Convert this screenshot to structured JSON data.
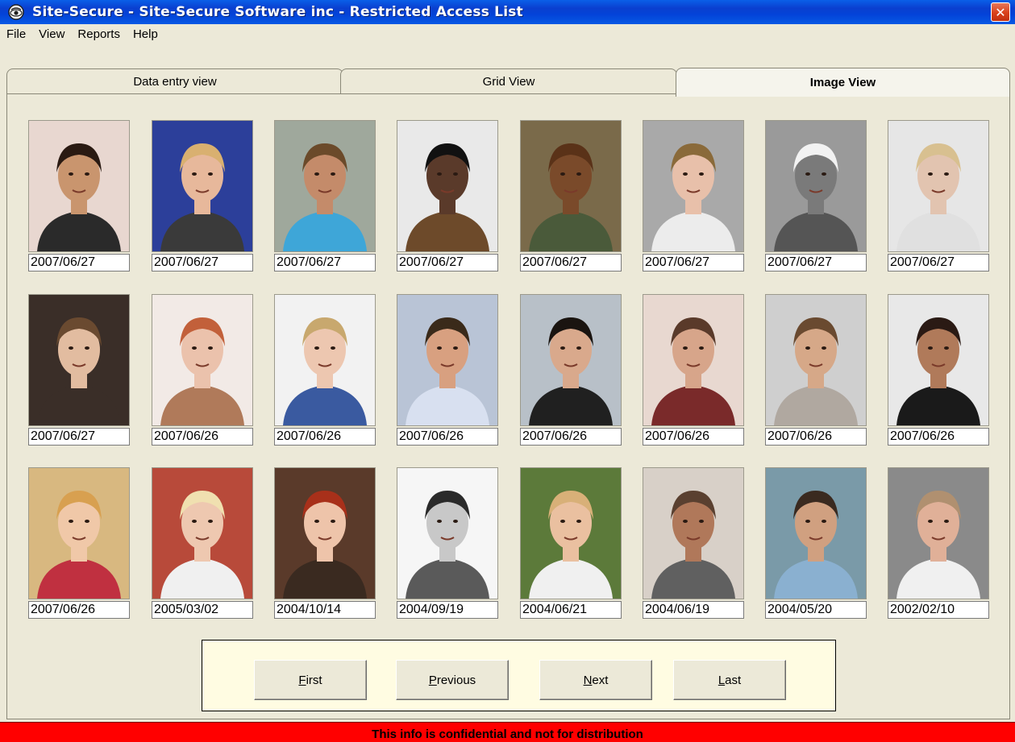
{
  "window": {
    "title": "Site-Secure - Site-Secure Software inc - Restricted Access List",
    "close_symbol": "✕"
  },
  "menu": [
    "File",
    "View",
    "Reports",
    "Help"
  ],
  "tabs": [
    {
      "label": "Data entry view",
      "active": false
    },
    {
      "label": "Grid View",
      "active": false
    },
    {
      "label": "Image View",
      "active": true
    }
  ],
  "photos": [
    {
      "date": "2007/06/27"
    },
    {
      "date": "2007/06/27"
    },
    {
      "date": "2007/06/27"
    },
    {
      "date": "2007/06/27"
    },
    {
      "date": "2007/06/27"
    },
    {
      "date": "2007/06/27"
    },
    {
      "date": "2007/06/27"
    },
    {
      "date": "2007/06/27"
    },
    {
      "date": "2007/06/27"
    },
    {
      "date": "2007/06/26"
    },
    {
      "date": "2007/06/26"
    },
    {
      "date": "2007/06/26"
    },
    {
      "date": "2007/06/26"
    },
    {
      "date": "2007/06/26"
    },
    {
      "date": "2007/06/26"
    },
    {
      "date": "2007/06/26"
    },
    {
      "date": "2007/06/26"
    },
    {
      "date": "2005/03/02"
    },
    {
      "date": "2004/10/14"
    },
    {
      "date": "2004/09/19"
    },
    {
      "date": "2004/06/21"
    },
    {
      "date": "2004/06/19"
    },
    {
      "date": "2004/05/20"
    },
    {
      "date": "2002/02/10"
    }
  ],
  "navigation": {
    "first": {
      "mnemonic": "F",
      "rest": "irst"
    },
    "previous": {
      "mnemonic": "P",
      "rest": "revious"
    },
    "next": {
      "mnemonic": "N",
      "rest": "ext"
    },
    "last": {
      "mnemonic": "L",
      "rest": "ast"
    }
  },
  "status": "This info is confidential and not for distribution",
  "colors": {
    "titlebar": "#0A3FCF",
    "window_bg": "#ECE9D8",
    "nav_panel_bg": "#FFFCE2",
    "status_bg": "#FF0000"
  },
  "icons": {
    "app": "eye-icon",
    "close": "close-icon"
  }
}
